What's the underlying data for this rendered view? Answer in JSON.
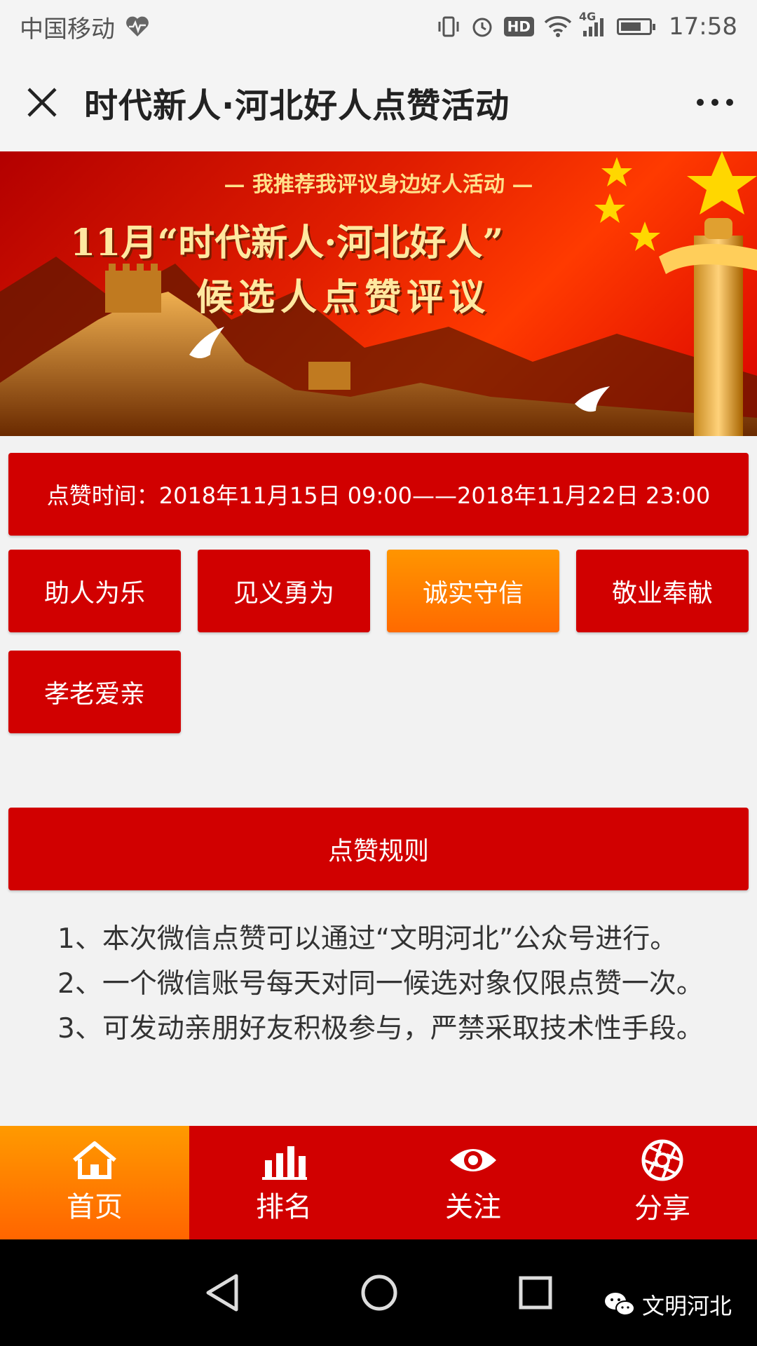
{
  "status_bar": {
    "carrier": "中国移动",
    "hd_badge": "HD",
    "network": "4G",
    "time": "17:58"
  },
  "nav": {
    "title": "时代新人·河北好人点赞活动"
  },
  "banner": {
    "subtitle": "我推荐我评议身边好人活动",
    "title_line1": "11月“时代新人·河北好人”",
    "title_line2": "候选人点赞评议"
  },
  "vote_time": "点赞时间：2018年11月15日 09:00——2018年11月22日 23:00",
  "categories": [
    {
      "label": "助人为乐",
      "active": false
    },
    {
      "label": "见义勇为",
      "active": false
    },
    {
      "label": "诚实守信",
      "active": true
    },
    {
      "label": "敬业奉献",
      "active": false
    },
    {
      "label": "孝老爱亲",
      "active": false
    }
  ],
  "rules": {
    "header": "点赞规则",
    "items": [
      "1、本次微信点赞可以通过“文明河北”公众号进行。",
      "2、一个微信账号每天对同一候选对象仅限点赞一次。",
      "3、可发动亲朋好友积极参与，严禁采取技术性手段。"
    ]
  },
  "tabs": [
    {
      "label": "首页",
      "icon": "home-icon",
      "active": true
    },
    {
      "label": "排名",
      "icon": "bar-chart-icon",
      "active": false
    },
    {
      "label": "关注",
      "icon": "eye-icon",
      "active": false
    },
    {
      "label": "分享",
      "icon": "shutter-icon",
      "active": false
    }
  ],
  "watermark": "文明河北",
  "colors": {
    "primary_red": "#d10000",
    "active_orange": "#ff7a00"
  }
}
